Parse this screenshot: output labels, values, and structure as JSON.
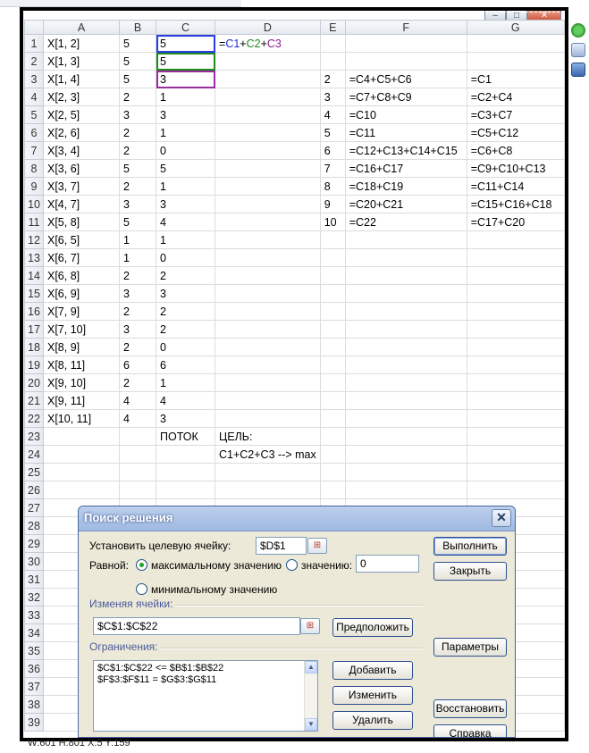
{
  "columns": [
    "",
    "A",
    "B",
    "C",
    "D",
    "E",
    "F",
    "G"
  ],
  "rows": [
    {
      "n": "1",
      "A": "X[1, 2]",
      "B": "5",
      "C": "5",
      "D": "",
      "E": "",
      "F": "",
      "G": ""
    },
    {
      "n": "2",
      "A": "X[1, 3]",
      "B": "5",
      "C": "5",
      "D": "",
      "E": "",
      "F": "",
      "G": ""
    },
    {
      "n": "3",
      "A": "X[1, 4]",
      "B": "5",
      "C": "3",
      "D": "",
      "E": "2",
      "F": "=C4+C5+C6",
      "G": "=C1"
    },
    {
      "n": "4",
      "A": "X[2, 3]",
      "B": "2",
      "C": "1",
      "D": "",
      "E": "3",
      "F": "=C7+C8+C9",
      "G": "=C2+C4"
    },
    {
      "n": "5",
      "A": "X[2, 5]",
      "B": "3",
      "C": "3",
      "D": "",
      "E": "4",
      "F": "=C10",
      "G": "=C3+C7"
    },
    {
      "n": "6",
      "A": "X[2, 6]",
      "B": "2",
      "C": "1",
      "D": "",
      "E": "5",
      "F": "=C11",
      "G": "=C5+C12"
    },
    {
      "n": "7",
      "A": "X[3, 4]",
      "B": "2",
      "C": "0",
      "D": "",
      "E": "6",
      "F": "=C12+C13+C14+C15",
      "G": "=C6+C8"
    },
    {
      "n": "8",
      "A": "X[3, 6]",
      "B": "5",
      "C": "5",
      "D": "",
      "E": "7",
      "F": "=C16+C17",
      "G": "=C9+C10+C13"
    },
    {
      "n": "9",
      "A": "X[3, 7]",
      "B": "2",
      "C": "1",
      "D": "",
      "E": "8",
      "F": "=C18+C19",
      "G": "=C11+C14"
    },
    {
      "n": "10",
      "A": "X[4, 7]",
      "B": "3",
      "C": "3",
      "D": "",
      "E": "9",
      "F": "=C20+C21",
      "G": "=C15+C16+C18"
    },
    {
      "n": "11",
      "A": "X[5, 8]",
      "B": "5",
      "C": "4",
      "D": "",
      "E": "10",
      "F": "=C22",
      "G": "=C17+C20"
    },
    {
      "n": "12",
      "A": "X[6, 5]",
      "B": "1",
      "C": "1",
      "D": "",
      "E": "",
      "F": "",
      "G": ""
    },
    {
      "n": "13",
      "A": "X[6, 7]",
      "B": "1",
      "C": "0",
      "D": "",
      "E": "",
      "F": "",
      "G": ""
    },
    {
      "n": "14",
      "A": "X[6, 8]",
      "B": "2",
      "C": "2",
      "D": "",
      "E": "",
      "F": "",
      "G": ""
    },
    {
      "n": "15",
      "A": "X[6, 9]",
      "B": "3",
      "C": "3",
      "D": "",
      "E": "",
      "F": "",
      "G": ""
    },
    {
      "n": "16",
      "A": "X[7, 9]",
      "B": "2",
      "C": "2",
      "D": "",
      "E": "",
      "F": "",
      "G": ""
    },
    {
      "n": "17",
      "A": "X[7, 10]",
      "B": "3",
      "C": "2",
      "D": "",
      "E": "",
      "F": "",
      "G": ""
    },
    {
      "n": "18",
      "A": "X[8, 9]",
      "B": "2",
      "C": "0",
      "D": "",
      "E": "",
      "F": "",
      "G": ""
    },
    {
      "n": "19",
      "A": "X[8, 11]",
      "B": "6",
      "C": "6",
      "D": "",
      "E": "",
      "F": "",
      "G": ""
    },
    {
      "n": "20",
      "A": "X[9, 10]",
      "B": "2",
      "C": "1",
      "D": "",
      "E": "",
      "F": "",
      "G": ""
    },
    {
      "n": "21",
      "A": "X[9, 11]",
      "B": "4",
      "C": "4",
      "D": "",
      "E": "",
      "F": "",
      "G": ""
    },
    {
      "n": "22",
      "A": "X[10, 11]",
      "B": "4",
      "C": "3",
      "D": "",
      "E": "",
      "F": "",
      "G": ""
    },
    {
      "n": "23",
      "A": "",
      "B": "",
      "C": "ПОТОК",
      "D": "ЦЕЛЬ:",
      "E": "",
      "F": "",
      "G": ""
    },
    {
      "n": "24",
      "A": "",
      "B": "",
      "C": "",
      "D": "C1+C2+C3 --> max",
      "E": "",
      "F": "",
      "G": ""
    },
    {
      "n": "25",
      "A": "",
      "B": "",
      "C": "",
      "D": "",
      "E": "",
      "F": "",
      "G": ""
    },
    {
      "n": "26",
      "A": "",
      "B": "",
      "C": "",
      "D": "",
      "E": "",
      "F": "",
      "G": ""
    },
    {
      "n": "27",
      "A": "",
      "B": "",
      "C": "",
      "D": "",
      "E": "",
      "F": "",
      "G": ""
    },
    {
      "n": "28",
      "A": "",
      "B": "",
      "C": "",
      "D": "",
      "E": "",
      "F": "",
      "G": ""
    },
    {
      "n": "29",
      "A": "",
      "B": "",
      "C": "",
      "D": "",
      "E": "",
      "F": "",
      "G": ""
    },
    {
      "n": "30",
      "A": "",
      "B": "",
      "C": "",
      "D": "",
      "E": "",
      "F": "",
      "G": ""
    },
    {
      "n": "31",
      "A": "",
      "B": "",
      "C": "",
      "D": "",
      "E": "",
      "F": "",
      "G": ""
    },
    {
      "n": "32",
      "A": "",
      "B": "",
      "C": "",
      "D": "",
      "E": "",
      "F": "",
      "G": ""
    },
    {
      "n": "33",
      "A": "",
      "B": "",
      "C": "",
      "D": "",
      "E": "",
      "F": "",
      "G": ""
    },
    {
      "n": "34",
      "A": "",
      "B": "",
      "C": "",
      "D": "",
      "E": "",
      "F": "",
      "G": ""
    },
    {
      "n": "35",
      "A": "",
      "B": "",
      "C": "",
      "D": "",
      "E": "",
      "F": "",
      "G": ""
    },
    {
      "n": "36",
      "A": "",
      "B": "",
      "C": "",
      "D": "",
      "E": "",
      "F": "",
      "G": ""
    },
    {
      "n": "37",
      "A": "",
      "B": "",
      "C": "",
      "D": "",
      "E": "",
      "F": "",
      "G": ""
    },
    {
      "n": "38",
      "A": "",
      "B": "",
      "C": "",
      "D": "",
      "E": "",
      "F": "",
      "G": ""
    },
    {
      "n": "39",
      "A": "",
      "B": "",
      "C": "",
      "D": "",
      "E": "",
      "F": "",
      "G": ""
    }
  ],
  "d1_formula": {
    "eq": "=",
    "p1": "C1",
    "plus1": "+",
    "p2": "C2",
    "plus2": "+",
    "p3": "C3"
  },
  "window_controls": {
    "minimize": "–",
    "restore": "□",
    "close": "✕"
  },
  "dialog": {
    "title": "Поиск решения",
    "close_glyph": "✕",
    "target_label": "Установить целевую ячейку:",
    "target_value": "$D$1",
    "equal_label": "Равной:",
    "opt_max": "максимальному значению",
    "opt_value": "значению:",
    "value_field": "0",
    "opt_min": "минимальному значению",
    "changing_label": "Изменяя ячейки:",
    "changing_value": "$C$1:$C$22",
    "constraints_label": "Ограничения:",
    "constraints": [
      "$C$1:$C$22 <= $B$1:$B$22",
      "$F$3:$F$11 = $G$3:$G$11"
    ],
    "btn_solve": "Выполнить",
    "btn_close": "Закрыть",
    "btn_guess": "Предположить",
    "btn_options": "Параметры",
    "btn_add": "Добавить",
    "btn_change": "Изменить",
    "btn_delete": "Удалить",
    "btn_reset": "Восстановить",
    "btn_help": "Справка",
    "ref_glyph": "⊞",
    "scroll_up": "▲",
    "scroll_down": "▼"
  },
  "status_text": "W:601 H:801 X:5 Y:159",
  "colors": {
    "blue": "#1a2cd6",
    "green": "#1c8a1c",
    "purple": "#8a1c8a"
  }
}
